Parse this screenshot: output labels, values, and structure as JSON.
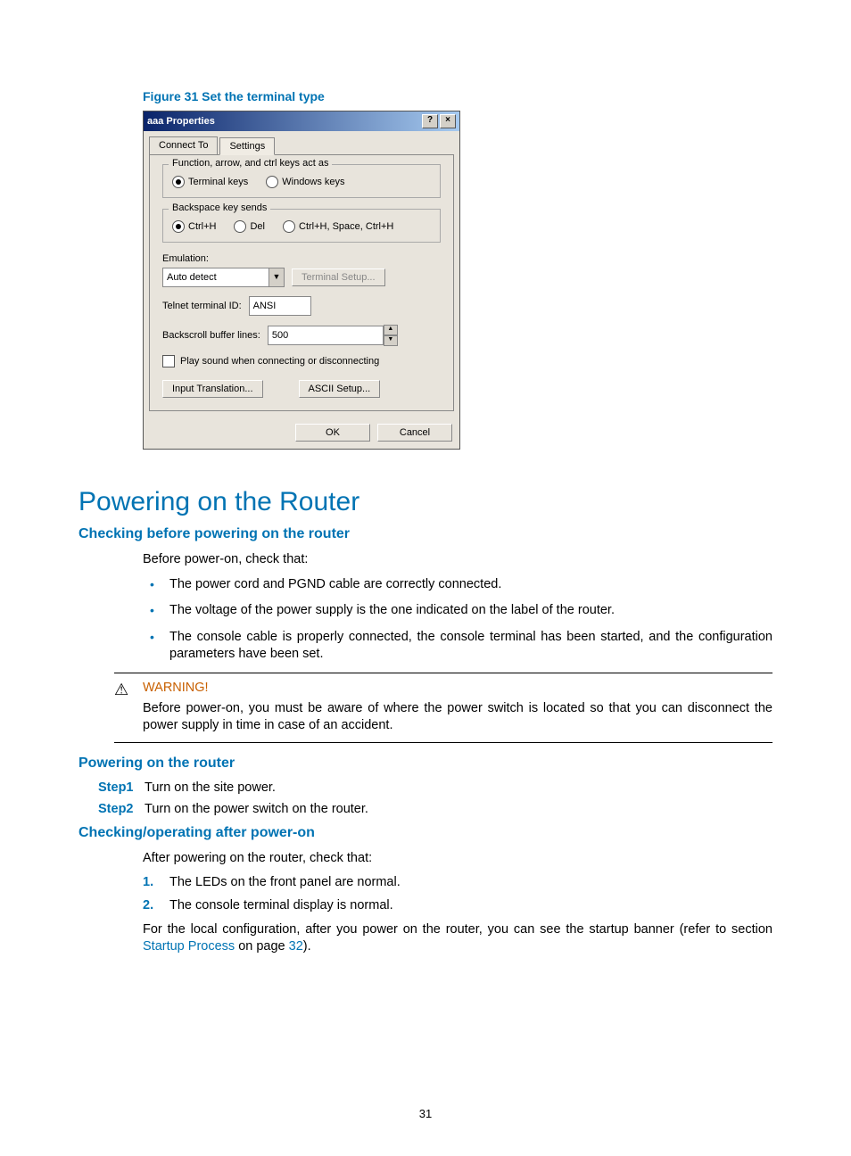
{
  "figure_caption": "Figure 31 Set the terminal type",
  "dialog": {
    "title": "aaa Properties",
    "help_btn": "?",
    "close_btn": "×",
    "tabs": {
      "connect": "Connect To",
      "settings": "Settings"
    },
    "group_keys": {
      "legend": "Function, arrow, and ctrl keys act as",
      "opt_terminal": "Terminal keys",
      "opt_windows": "Windows keys"
    },
    "group_backspace": {
      "legend": "Backspace key sends",
      "opt_ctrlh": "Ctrl+H",
      "opt_del": "Del",
      "opt_chsch": "Ctrl+H, Space, Ctrl+H"
    },
    "emulation_label": "Emulation:",
    "emulation_value": "Auto detect",
    "terminal_setup_btn": "Terminal Setup...",
    "telnet_label": "Telnet terminal ID:",
    "telnet_value": "ANSI",
    "backscroll_label": "Backscroll buffer lines:",
    "backscroll_value": "500",
    "playsound_label": "Play sound when connecting or disconnecting",
    "input_trans_btn": "Input Translation...",
    "ascii_btn": "ASCII Setup...",
    "ok_btn": "OK",
    "cancel_btn": "Cancel"
  },
  "h1": "Powering on the Router",
  "h2_check_before": "Checking before powering on the router",
  "before_intro": "Before power-on, check that:",
  "bullets_before": {
    "b1": "The power cord and PGND cable are correctly connected.",
    "b2": "The voltage of the power supply is the one indicated on the label of the router.",
    "b3": "The console cable is properly connected, the console terminal has been started, and the configuration parameters have been set."
  },
  "warning": {
    "title": "WARNING!",
    "text": "Before power-on, you must be aware of where the power switch is located so that you can disconnect the power supply in time in case of an accident."
  },
  "h2_power_on": "Powering on the router",
  "steps": {
    "s1_label": "Step1",
    "s1_text": "Turn on the site power.",
    "s2_label": "Step2",
    "s2_text": "Turn on the power switch on the router."
  },
  "h2_after": "Checking/operating after power-on",
  "after_intro": "After powering on the router, check that:",
  "numlist": {
    "n1": "The LEDs on the front panel are normal.",
    "n2": "The console terminal display is normal."
  },
  "closing_pre": "For the local configuration, after you power on the router, you can see the startup banner (refer to section ",
  "closing_link1": "Startup Process",
  "closing_mid": " on page ",
  "closing_link2": "32",
  "closing_post": ").",
  "page_number": "31"
}
